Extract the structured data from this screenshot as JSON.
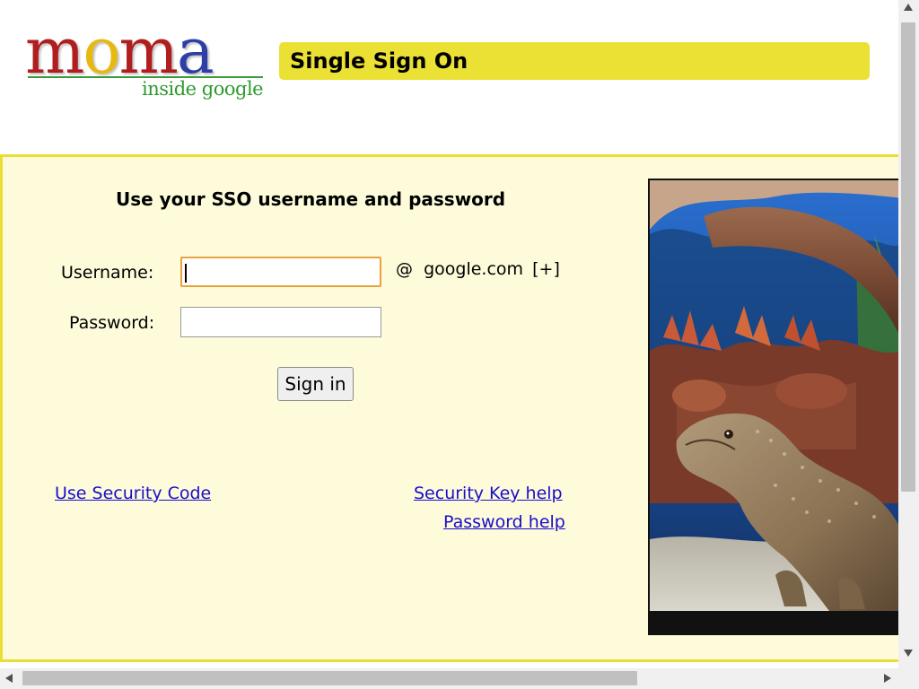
{
  "header": {
    "logo": {
      "letters": [
        {
          "char": "m",
          "color": "#b01e1e"
        },
        {
          "char": "o",
          "color": "#e7b80f"
        },
        {
          "char": "m",
          "color": "#b01e1e"
        },
        {
          "char": "a",
          "color": "#2d3fa6"
        }
      ],
      "tagline": "inside google",
      "tagline_color": "#2e9a2e"
    },
    "title": "Single Sign On",
    "title_bar_color": "#ebe034"
  },
  "login": {
    "heading": "Use your SSO username and password",
    "username_label": "Username:",
    "username_value": "",
    "password_label": "Password:",
    "password_value": "",
    "domain_at": "@",
    "domain": "google.com",
    "domain_expand": "[+]",
    "submit_label": "Sign in"
  },
  "links": {
    "security_code": "Use Security Code",
    "security_key_help": "Security Key help",
    "password_help": "Password help",
    "link_color": "#1a0dcc"
  },
  "panel": {
    "background": "#fdfbda",
    "border_color": "#eadd36"
  },
  "photo": {
    "subject": "bearded-dragon-lizard-in-aquarium"
  }
}
